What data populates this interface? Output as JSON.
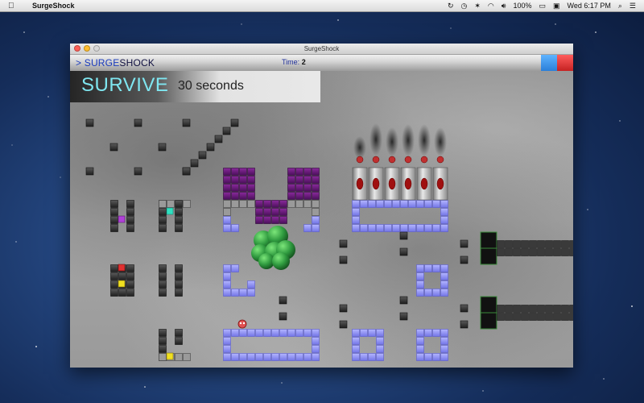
{
  "menubar": {
    "app_name": "SurgeShock",
    "battery": "100%",
    "clock": "Wed 6:17 PM"
  },
  "window": {
    "title": "SurgeShock",
    "brand_prefix": "> SURGE",
    "brand_suffix": "SHOCK",
    "time_label": "Time:",
    "time_value": "2"
  },
  "objective": {
    "title": "SURVIVE",
    "subtitle": "30 seconds"
  },
  "colors": {
    "accent_cyan": "#7fe6f0",
    "purple_blocks": "#6a1a7a",
    "blue_blocks": "#8a8cf0",
    "green_player": "#2f9a3f",
    "blue_button": "#2a7fd9",
    "red_button": "#c52222"
  }
}
